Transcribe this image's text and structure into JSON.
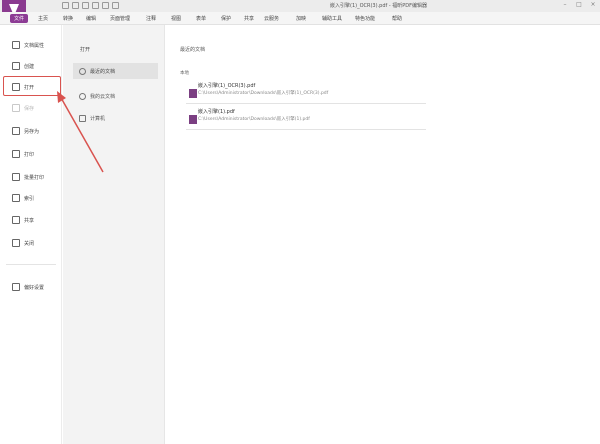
{
  "window": {
    "title": "嵌入引擎(1)_OCR(3).pdf - 福昕PDF编辑器"
  },
  "menu": {
    "items": [
      "文件",
      "主页",
      "转换",
      "编辑",
      "页面管理",
      "注释",
      "视图",
      "表单",
      "保护",
      "共享",
      "云服务",
      "加映",
      "辅助工具",
      "特色功能",
      "帮助"
    ]
  },
  "sidebar": {
    "items": [
      {
        "label": "文档属性",
        "icon": "document-properties-icon",
        "disabled": false
      },
      {
        "label": "创建",
        "icon": "create-icon",
        "disabled": false
      },
      {
        "label": "打开",
        "icon": "open-icon",
        "disabled": false
      },
      {
        "label": "保存",
        "icon": "save-icon",
        "disabled": true
      },
      {
        "label": "另存为",
        "icon": "save-as-icon",
        "disabled": false
      },
      {
        "label": "打印",
        "icon": "print-icon",
        "disabled": false
      },
      {
        "label": "批量打印",
        "icon": "batch-print-icon",
        "disabled": false
      },
      {
        "label": "索引",
        "icon": "index-icon",
        "disabled": false
      },
      {
        "label": "共享",
        "icon": "share-icon",
        "disabled": false
      },
      {
        "label": "关闭",
        "icon": "close-icon",
        "disabled": false
      },
      {
        "label": "偏好设置",
        "icon": "preferences-icon",
        "disabled": false
      }
    ]
  },
  "open_panel": {
    "header": "打开",
    "items": [
      {
        "label": "最近的文档",
        "icon": "clock-icon",
        "selected": true
      },
      {
        "label": "我的云文档",
        "icon": "cloud-icon",
        "selected": false
      },
      {
        "label": "计算机",
        "icon": "computer-icon",
        "selected": false
      }
    ]
  },
  "main": {
    "title": "最近的文档",
    "section": "本地",
    "files": [
      {
        "name": "嵌入引擎(1)_OCR(3).pdf",
        "path": "C:\\Users\\Administrator\\Downloads\\嵌入引擎(1)_OCR(3).pdf"
      },
      {
        "name": "嵌入引擎(1).pdf",
        "path": "C:\\Users\\Administrator\\Downloads\\嵌入引擎(1).pdf"
      }
    ]
  },
  "colors": {
    "brand": "#8c3b94",
    "highlight": "#d9534f",
    "file_icon": "#7b3f82"
  }
}
